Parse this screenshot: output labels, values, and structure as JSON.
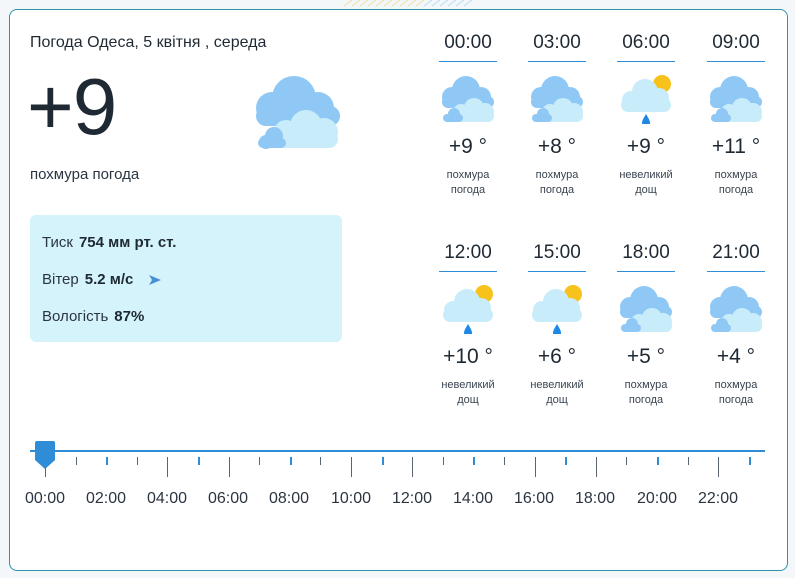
{
  "header": {
    "title": "Погода Одеса, 5 квітня , середа",
    "temperature": "+9",
    "condition": "похмура погода"
  },
  "details": {
    "pressure_label": "Тиск",
    "pressure_value": "754 мм рт. ст.",
    "wind_label": "Вітер",
    "wind_value": "5.2 м/с",
    "humidity_label": "Вологість",
    "humidity_value": "87%"
  },
  "hourly": [
    {
      "time": "00:00",
      "temp": "+9 °",
      "desc1": "похмура",
      "desc2": "погода",
      "icon": "cloudy-icon"
    },
    {
      "time": "03:00",
      "temp": "+8 °",
      "desc1": "похмура",
      "desc2": "погода",
      "icon": "cloudy-icon"
    },
    {
      "time": "06:00",
      "temp": "+9 °",
      "desc1": "невеликий",
      "desc2": "дощ",
      "icon": "light-rain-sun-icon"
    },
    {
      "time": "09:00",
      "temp": "+11 °",
      "desc1": "похмура",
      "desc2": "погода",
      "icon": "cloudy-icon"
    },
    {
      "time": "12:00",
      "temp": "+10 °",
      "desc1": "невеликий",
      "desc2": "дощ",
      "icon": "light-rain-sun-icon"
    },
    {
      "time": "15:00",
      "temp": "+6 °",
      "desc1": "невеликий",
      "desc2": "дощ",
      "icon": "light-rain-sun-icon"
    },
    {
      "time": "18:00",
      "temp": "+5 °",
      "desc1": "похмура",
      "desc2": "погода",
      "icon": "cloudy-icon"
    },
    {
      "time": "21:00",
      "temp": "+4 °",
      "desc1": "похмура",
      "desc2": "погода",
      "icon": "cloudy-icon"
    }
  ],
  "timeline": {
    "labels": [
      "00:00",
      "02:00",
      "04:00",
      "06:00",
      "08:00",
      "10:00",
      "12:00",
      "14:00",
      "16:00",
      "18:00",
      "20:00",
      "22:00"
    ],
    "selected": "00:00"
  },
  "colors": {
    "accent": "#2f8dd8",
    "border": "#2f93a8",
    "info_bg": "#d4f3fb",
    "cloud_dark": "#8fc8f5",
    "cloud_light": "#c9ecfb",
    "sun": "#f7c21b",
    "rain": "#1e88e5"
  }
}
